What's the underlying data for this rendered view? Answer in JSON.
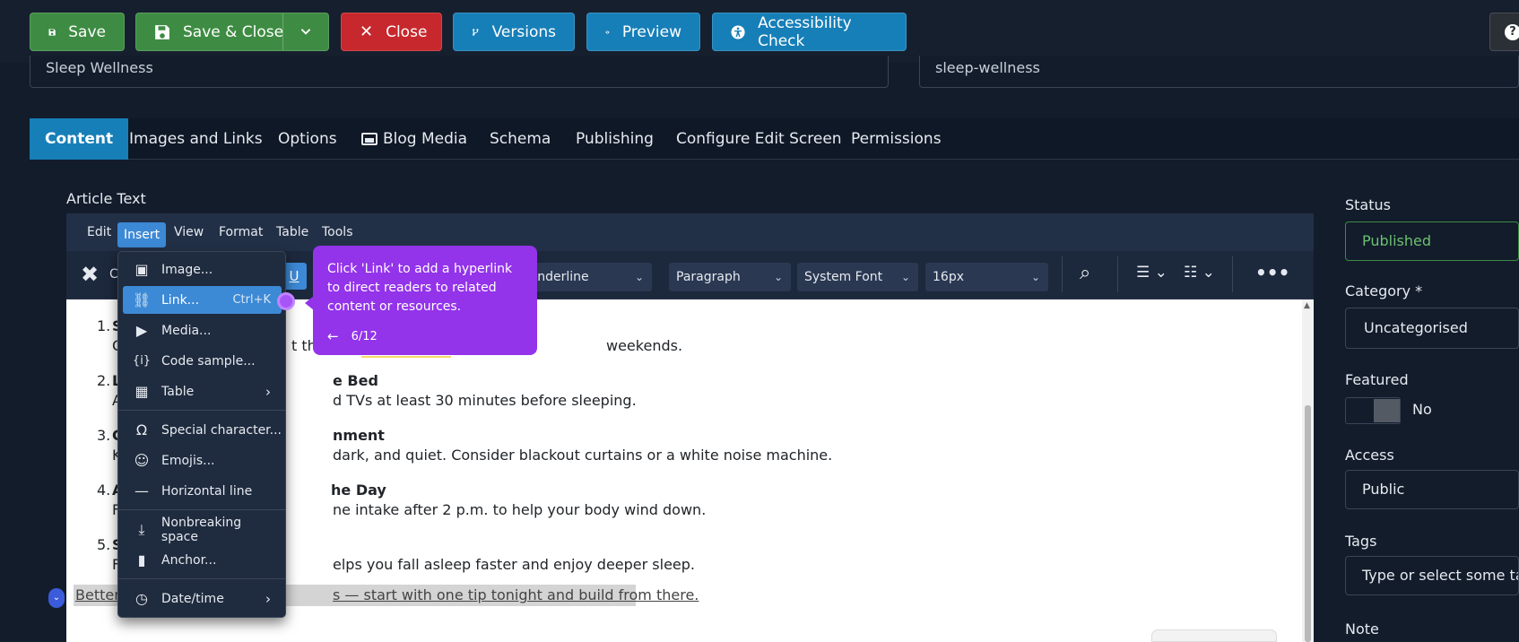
{
  "toolbar": {
    "save": "Save",
    "save_close": "Save & Close",
    "close": "Close",
    "versions": "Versions",
    "preview": "Preview",
    "accessibility": "Accessibility Check",
    "help": "?"
  },
  "fields": {
    "title": "Sleep Wellness",
    "alias": "sleep-wellness"
  },
  "tabs": [
    "Content",
    "Images and Links",
    "Options",
    "Blog Media",
    "Schema",
    "Publishing",
    "Configure Edit Screen",
    "Permissions"
  ],
  "editor": {
    "label": "Article Text",
    "menubar": [
      "Edit",
      "Insert",
      "View",
      "Format",
      "Table",
      "Tools"
    ],
    "toolbar": {
      "underline_btn": "U",
      "style_select": "Underline",
      "block_select": "Paragraph",
      "font_select": "System Font",
      "size_select": "16px",
      "c_label": "C"
    },
    "content": [
      {
        "num": "1.",
        "head": "S",
        "body_pre": "C",
        "body": "t the",
        "body_post": "weekends."
      },
      {
        "num": "2.",
        "head": "L",
        "head_tail": "e Bed",
        "body_pre": "A",
        "body": "d TVs at least 30 minutes before sleeping."
      },
      {
        "num": "3.",
        "head": "C",
        "head_tail": "nment",
        "body_pre": "K",
        "body": "dark, and quiet. Consider blackout curtains or a white noise machine."
      },
      {
        "num": "4.",
        "head": "A",
        "head_tail": "he Day",
        "body_pre": "F",
        "body": "ne intake after 2 p.m. to help your body wind down."
      },
      {
        "num": "5.",
        "head": "S",
        "body_pre": "F",
        "body": "elps you fall asleep faster and enjoy deeper sleep."
      }
    ],
    "last_line_start": "Better",
    "last_line_end": "s — start with one tip tonight and build from there."
  },
  "insert_menu": {
    "items": [
      {
        "label": "Image...",
        "icon": "image-icon",
        "glyph": "▣"
      },
      {
        "label": "Link...",
        "icon": "link-icon",
        "glyph": "🔗",
        "shortcut": "Ctrl+K"
      },
      {
        "label": "Media...",
        "icon": "media-icon",
        "glyph": "▶"
      },
      {
        "label": "Code sample...",
        "icon": "code-icon",
        "glyph": "{}"
      },
      {
        "label": "Table",
        "icon": "table-icon",
        "glyph": "▦"
      },
      {
        "label": "Special character...",
        "icon": "omega-icon",
        "glyph": "Ω"
      },
      {
        "label": "Emojis...",
        "icon": "emoji-icon",
        "glyph": "☺"
      },
      {
        "label": "Horizontal line",
        "icon": "hr-icon",
        "glyph": "—"
      },
      {
        "label": "Nonbreaking space",
        "icon": "nbsp-icon",
        "glyph": "⇲"
      },
      {
        "label": "Anchor...",
        "icon": "bookmark-icon",
        "glyph": "▮"
      },
      {
        "label": "Date/time",
        "icon": "clock-icon",
        "glyph": "◷"
      }
    ]
  },
  "tooltip": {
    "text": "Click 'Link' to add a hyperlink to direct readers to related content or resources.",
    "progress": "6/12",
    "color": "#9333ea"
  },
  "sidebar": {
    "status_label": "Status",
    "status_value": "Published",
    "category_label": "Category *",
    "category_value": "Uncategorised",
    "featured_label": "Featured",
    "featured_value": "No",
    "access_label": "Access",
    "access_value": "Public",
    "tags_label": "Tags",
    "tags_placeholder": "Type or select some tags",
    "note_label": "Note"
  },
  "colors": {
    "save_green": "#3e8c43",
    "close_red": "#c7282d",
    "accent_blue": "#177fb8",
    "menu_highlight": "#3c89d6"
  }
}
